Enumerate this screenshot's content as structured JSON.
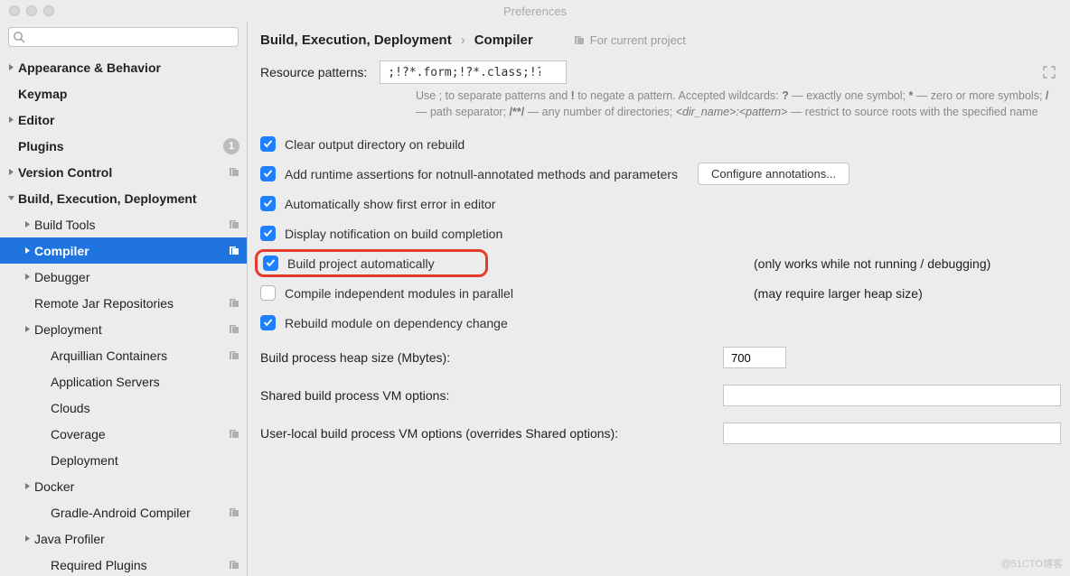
{
  "window": {
    "title": "Preferences"
  },
  "search": {
    "placeholder": ""
  },
  "sidebar": {
    "items": [
      {
        "label": "Appearance & Behavior",
        "level": 0,
        "bold": true,
        "arrow": "right"
      },
      {
        "label": "Keymap",
        "level": 0,
        "bold": true,
        "arrow": "none"
      },
      {
        "label": "Editor",
        "level": 0,
        "bold": true,
        "arrow": "right"
      },
      {
        "label": "Plugins",
        "level": 0,
        "bold": true,
        "arrow": "none",
        "badge": "1"
      },
      {
        "label": "Version Control",
        "level": 0,
        "bold": true,
        "arrow": "right",
        "proj": true
      },
      {
        "label": "Build, Execution, Deployment",
        "level": 0,
        "bold": true,
        "arrow": "down"
      },
      {
        "label": "Build Tools",
        "level": 1,
        "arrow": "right",
        "proj": true
      },
      {
        "label": "Compiler",
        "level": 1,
        "arrow": "right",
        "proj": true,
        "selected": true,
        "bold": true
      },
      {
        "label": "Debugger",
        "level": 1,
        "arrow": "right"
      },
      {
        "label": "Remote Jar Repositories",
        "level": 1,
        "arrow": "none",
        "proj": true
      },
      {
        "label": "Deployment",
        "level": 1,
        "arrow": "right",
        "proj": true
      },
      {
        "label": "Arquillian Containers",
        "level": 2,
        "arrow": "none",
        "proj": true
      },
      {
        "label": "Application Servers",
        "level": 2,
        "arrow": "none"
      },
      {
        "label": "Clouds",
        "level": 2,
        "arrow": "none"
      },
      {
        "label": "Coverage",
        "level": 2,
        "arrow": "none",
        "proj": true
      },
      {
        "label": "Deployment",
        "level": 2,
        "arrow": "none"
      },
      {
        "label": "Docker",
        "level": 1,
        "arrow": "right"
      },
      {
        "label": "Gradle-Android Compiler",
        "level": 2,
        "arrow": "none",
        "proj": true
      },
      {
        "label": "Java Profiler",
        "level": 1,
        "arrow": "right"
      },
      {
        "label": "Required Plugins",
        "level": 2,
        "arrow": "none",
        "proj": true
      }
    ]
  },
  "breadcrumb": {
    "a": "Build, Execution, Deployment",
    "b": "Compiler",
    "scope": "For current project"
  },
  "resource": {
    "label": "Resource patterns:",
    "value": ";!?*.form;!?*.class;!?*.groovy;!?*.scala;!?*.flex;!?*.kt;!?*.clj;!?*.aj",
    "help_a": "Use ; to separate patterns and ",
    "help_b": " to negate a pattern. Accepted wildcards: ",
    "help_c": " — exactly one symbol; ",
    "help_d": " — zero or more symbols; ",
    "help_e": " — path separator; ",
    "help_f": " — any number of directories; ",
    "help_g": " — restrict to source roots with the specified name",
    "bang": "!",
    "q": "?",
    "star": "*",
    "slash": "/",
    "dstar": "/**/",
    "dir": "<dir_name>:<pattern>"
  },
  "settings": {
    "s0": "Clear output directory on rebuild",
    "s1": "Add runtime assertions for notnull-annotated methods and parameters",
    "s1btn": "Configure annotations...",
    "s2": "Automatically show first error in editor",
    "s3": "Display notification on build completion",
    "s4": "Build project automatically",
    "s4note": "(only works while not running / debugging)",
    "s5": "Compile independent modules in parallel",
    "s5note": "(may require larger heap size)",
    "s6": "Rebuild module on dependency change"
  },
  "fields": {
    "f0": {
      "label": "Build process heap size (Mbytes):",
      "value": "700"
    },
    "f1": {
      "label": "Shared build process VM options:",
      "value": ""
    },
    "f2": {
      "label": "User-local build process VM options (overrides Shared options):",
      "value": ""
    }
  },
  "watermark": "@51CTO博客"
}
